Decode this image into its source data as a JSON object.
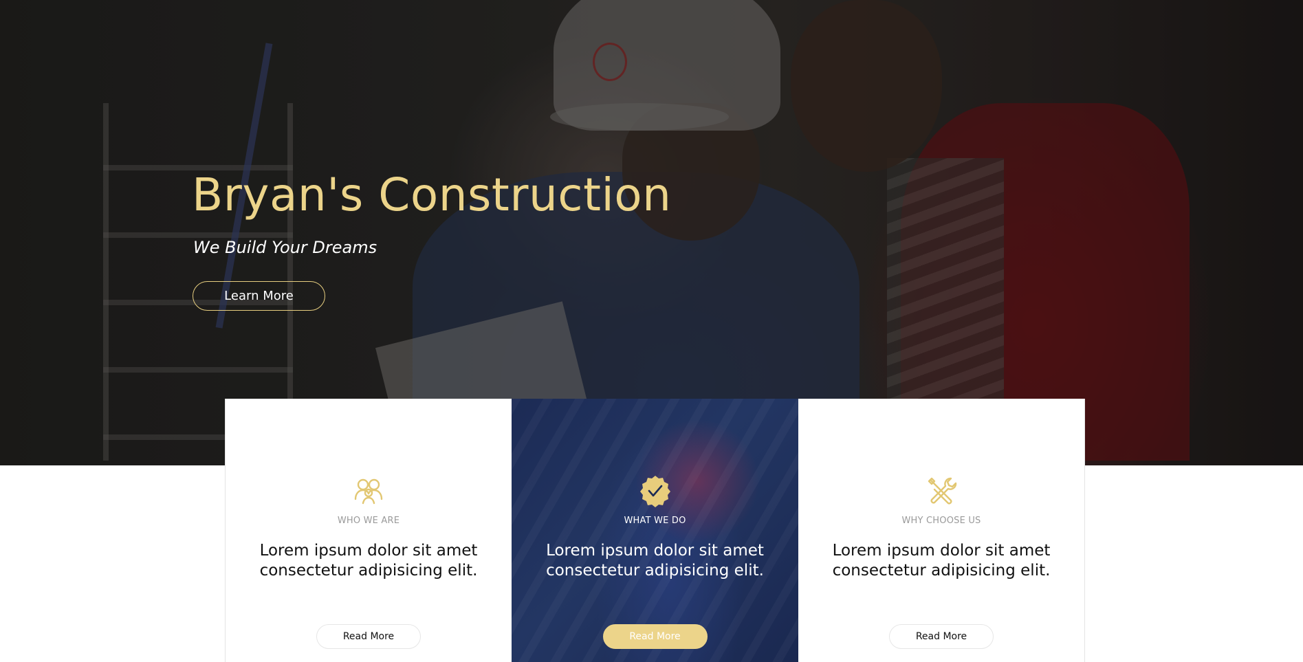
{
  "hero": {
    "title": "Bryan's Construction",
    "tagline": "We Build Your Dreams",
    "button_label": "Learn More"
  },
  "features": [
    {
      "icon": "people-icon",
      "label": "WHO WE ARE",
      "text": "Lorem ipsum dolor sit amet consectetur adipisicing elit.",
      "button_label": "Read More"
    },
    {
      "icon": "check-badge-icon",
      "label": "WHAT WE DO",
      "text": "Lorem ipsum dolor sit amet consectetur adipisicing elit.",
      "button_label": "Read More"
    },
    {
      "icon": "tools-icon",
      "label": "WHY CHOOSE US",
      "text": "Lorem ipsum dolor sit amet consectetur adipisicing elit.",
      "button_label": "Read More"
    }
  ],
  "colors": {
    "accent": "#ecd48a",
    "feature_highlight": "#1f2f5c"
  }
}
